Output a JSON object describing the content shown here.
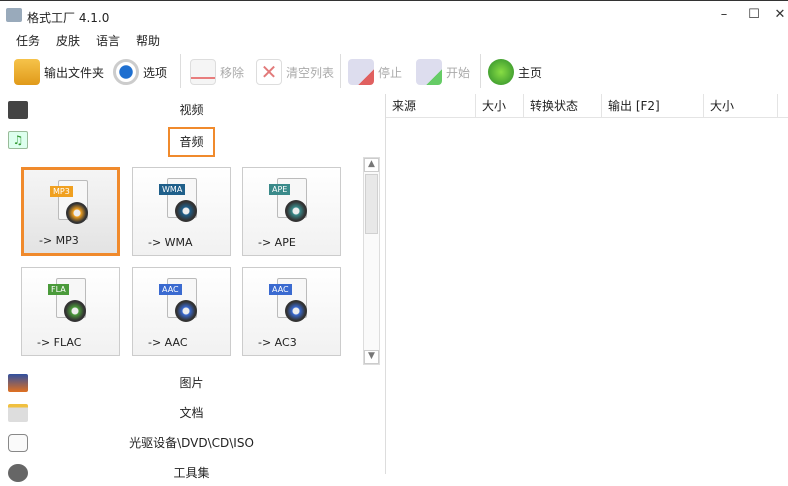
{
  "window": {
    "title": "格式工厂 4.1.0",
    "minimize": "–",
    "maximize": "☐",
    "close": "✕"
  },
  "menu": [
    "任务",
    "皮肤",
    "语言",
    "帮助"
  ],
  "toolbar": {
    "output_folder": "输出文件夹",
    "options": "选项",
    "remove": "移除",
    "clear_list": "清空列表",
    "stop": "停止",
    "start": "开始",
    "home": "主页"
  },
  "categories": {
    "video": "视频",
    "audio": "音频",
    "image": "图片",
    "document": "文档",
    "rom": "光驱设备\\DVD\\CD\\ISO",
    "tools": "工具集"
  },
  "audio_formats": [
    {
      "badge": "MP3",
      "label": "-> MP3",
      "color": "#f0a020"
    },
    {
      "badge": "WMA",
      "label": "-> WMA",
      "color": "#1f5f8a"
    },
    {
      "badge": "APE",
      "label": "-> APE",
      "color": "#3a8a8a"
    },
    {
      "badge": "FLA",
      "label": "-> FLAC",
      "color": "#4a9a3a"
    },
    {
      "badge": "AAC",
      "label": "-> AAC",
      "color": "#3a6ad0"
    },
    {
      "badge": "AAC",
      "label": "-> AC3",
      "color": "#3a6ad0"
    }
  ],
  "table": {
    "columns": [
      "来源",
      "大小",
      "转换状态",
      "输出 [F2]",
      "大小"
    ]
  }
}
